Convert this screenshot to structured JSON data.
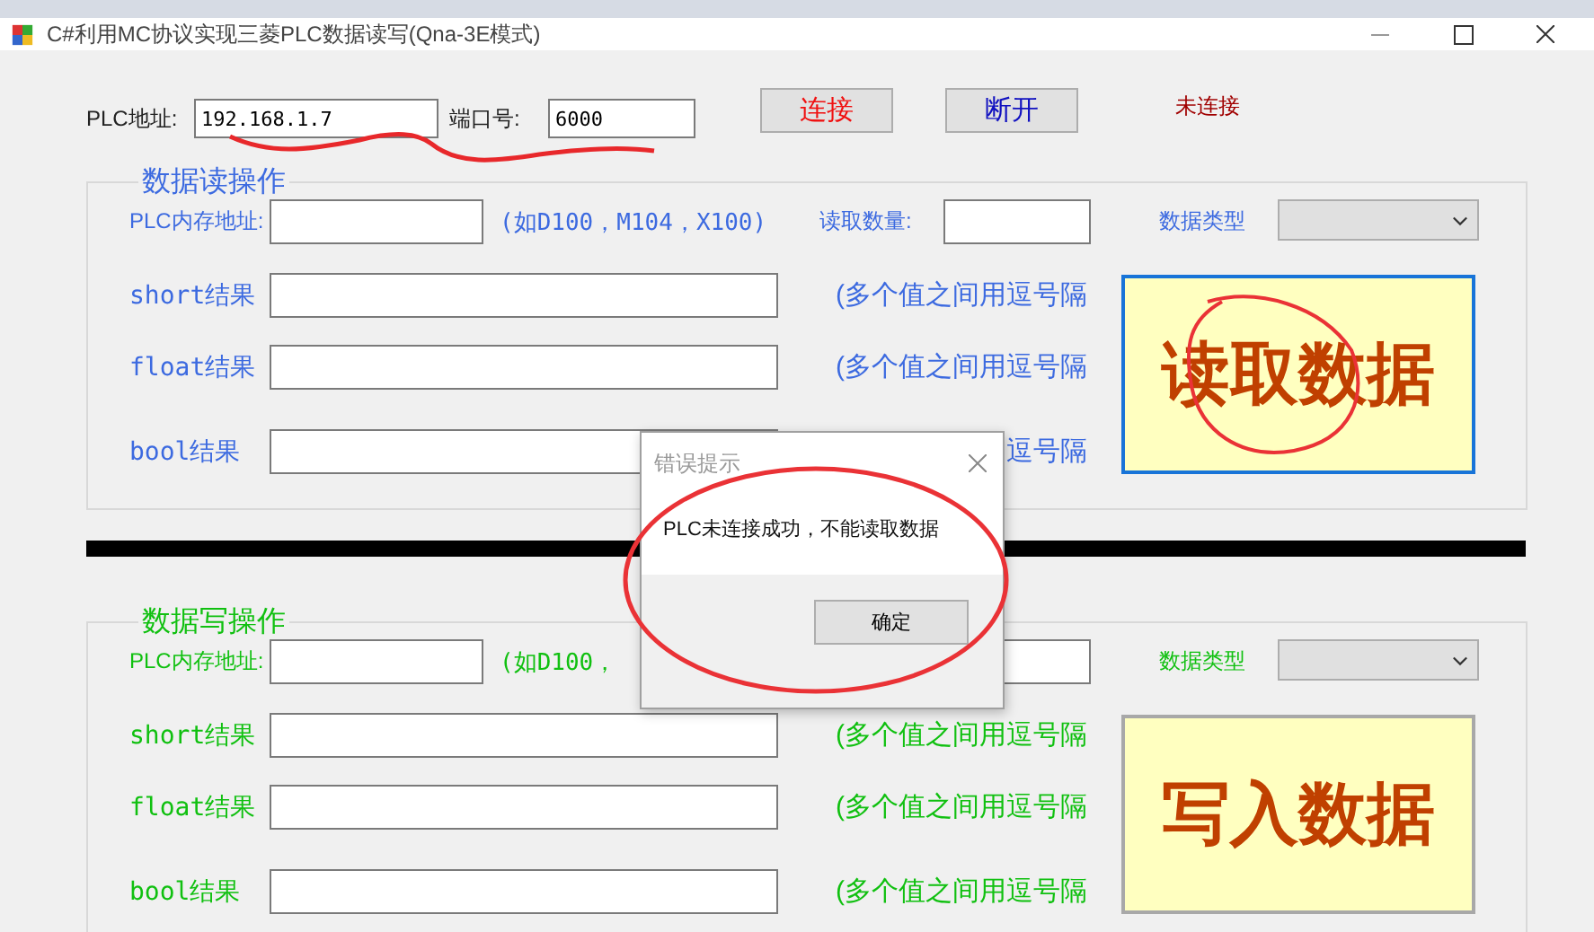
{
  "window": {
    "title": "C#利用MC协议实现三菱PLC数据读写(Qna-3E模式)"
  },
  "connection": {
    "address_label": "PLC地址:",
    "address": "192.168.1.7",
    "port_label": "端口号:",
    "port": "6000",
    "buttons": [
      {
        "label": "连接",
        "kind": "connect"
      },
      {
        "label": "断开",
        "kind": "disconnect"
      }
    ],
    "status": "未连接"
  },
  "groups": [
    {
      "kind": "read",
      "title": "数据读操作",
      "address_label": "PLC内存地址:",
      "address_hint": "(如D100，M104，X100)",
      "count_label": "读取数量:",
      "type_label": "数据类型",
      "action": "读取数据",
      "focused": true,
      "results": [
        {
          "label": "short结果",
          "hint": "(多个值之间用逗号隔"
        },
        {
          "label": "float结果",
          "hint": "(多个值之间用逗号隔"
        },
        {
          "label": "bool结果",
          "hint": "逗号隔"
        }
      ]
    },
    {
      "kind": "write",
      "title": "数据写操作",
      "address_label": "PLC内存地址:",
      "address_hint": "(如D100，",
      "type_label": "数据类型",
      "action": "写入数据",
      "focused": false,
      "results": [
        {
          "label": "short结果",
          "hint": "(多个值之间用逗号隔"
        },
        {
          "label": "float结果",
          "hint": "(多个值之间用逗号隔"
        },
        {
          "label": "bool结果",
          "hint": "(多个值之间用逗号隔"
        }
      ]
    }
  ],
  "dialog": {
    "title": "错误提示",
    "message": "PLC未连接成功，不能读取数据",
    "button": "确定"
  }
}
